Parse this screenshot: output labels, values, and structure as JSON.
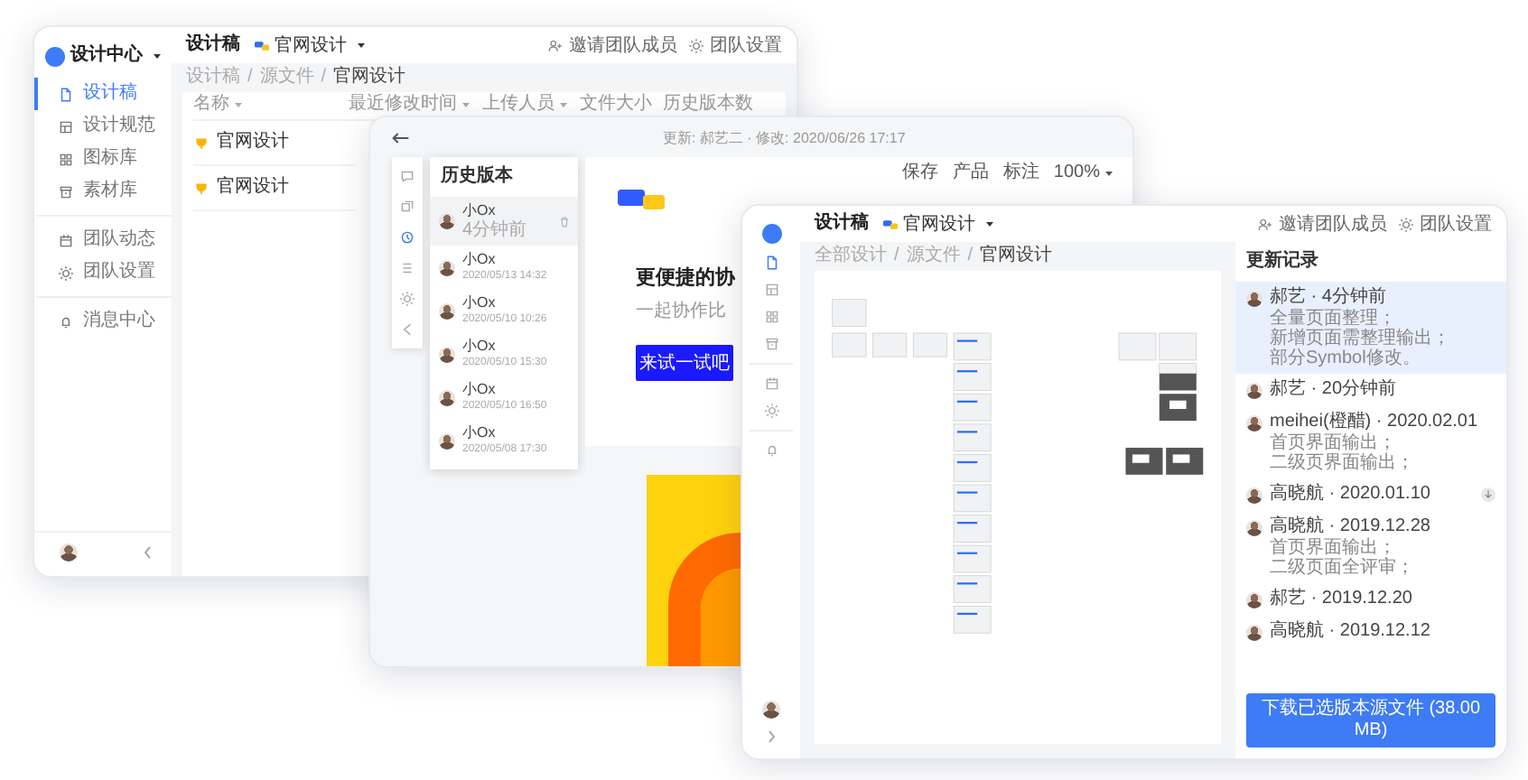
{
  "back_window": {
    "team": "设计中心",
    "nav": [
      {
        "label": "设计稿",
        "selected": true,
        "divider_before": false
      },
      {
        "label": "设计规范",
        "selected": false,
        "divider_before": false
      },
      {
        "label": "图标库",
        "selected": false,
        "divider_before": false
      },
      {
        "label": "素材库",
        "selected": false,
        "divider_before": false
      },
      {
        "label": "团队动态",
        "selected": false,
        "divider_before": true
      },
      {
        "label": "团队设置",
        "selected": false,
        "divider_before": false
      },
      {
        "label": "消息中心",
        "selected": false,
        "divider_before": true
      }
    ],
    "project": "设计稿",
    "file": "官网设计",
    "actions": [
      "邀请团队成员",
      "团队设置"
    ],
    "breadcrumb": [
      {
        "kind": "link",
        "text": "设计稿"
      },
      {
        "kind": "separator",
        "text": "/"
      },
      {
        "kind": "link",
        "text": "源文件"
      },
      {
        "kind": "separator",
        "text": "/"
      },
      {
        "kind": "current",
        "text": "官网设计"
      }
    ],
    "columns": [
      {
        "label": "名称",
        "sortable": true
      },
      {
        "label": "最近修改时间",
        "sortable": true
      },
      {
        "label": "上传人员",
        "sortable": true
      },
      {
        "label": "文件大小",
        "sortable": false
      },
      {
        "label": "历史版本数",
        "sortable": false
      }
    ],
    "rows": [
      {
        "name": "官网设计"
      },
      {
        "name": "官网设计"
      }
    ]
  },
  "middle_window": {
    "meta": "更新: 郝艺二 · 修改: 2020/06/26 17:17",
    "tools": [
      "保存",
      "产品",
      "标注"
    ],
    "zoom": "100%",
    "strip": [
      {
        "selected": false
      },
      {
        "selected": false
      },
      {
        "selected": true
      },
      {
        "selected": false
      },
      {
        "selected": false
      },
      {
        "selected": false
      }
    ],
    "history_title": "历史版本",
    "versions": [
      {
        "name": "小Ox",
        "time": "4分钟前",
        "selected": true
      },
      {
        "name": "小Ox",
        "time": "2020/05/13 14:32",
        "selected": false
      },
      {
        "name": "小Ox",
        "time": "2020/05/10 10:26",
        "selected": false
      },
      {
        "name": "小Ox",
        "time": "2020/05/10 15:30",
        "selected": false
      },
      {
        "name": "小Ox",
        "time": "2020/05/10 16:50",
        "selected": false
      },
      {
        "name": "小Ox",
        "time": "2020/05/08 17:30",
        "selected": false
      }
    ],
    "heading": "更便捷的协",
    "subtitle": "一起协作比",
    "cta": "来试一试吧"
  },
  "front_window": {
    "nav": [
      {
        "selected": true
      },
      {
        "selected": false
      },
      {
        "selected": false
      },
      {
        "selected": false
      },
      {
        "selected": false
      },
      {
        "selected": false
      },
      {
        "selected": false
      }
    ],
    "project": "设计稿",
    "file": "官网设计",
    "actions": [
      "邀请团队成员",
      "团队设置"
    ],
    "breadcrumb": [
      {
        "kind": "link",
        "text": "全部设计"
      },
      {
        "kind": "separator",
        "text": "/"
      },
      {
        "kind": "link",
        "text": "源文件"
      },
      {
        "kind": "separator",
        "text": "/"
      },
      {
        "kind": "current",
        "text": "官网设计"
      }
    ],
    "log_title": "更新记录",
    "log": [
      {
        "title": "郝艺 · 4分钟前",
        "notes": [
          "全量页面整理；",
          "新增页面需整理输出；",
          "部分Symbol修改。"
        ],
        "selected": true,
        "download": false
      },
      {
        "title": "郝艺 · 20分钟前",
        "selected": false,
        "download": false
      },
      {
        "title": "meihei(橙醋) · 2020.02.01",
        "notes": [
          "首页界面输出；",
          "二级页界面输出；"
        ],
        "selected": false,
        "download": false
      },
      {
        "title": "高晓航 · 2020.01.10",
        "selected": false,
        "download": true
      },
      {
        "title": "高晓航 · 2019.12.28",
        "notes": [
          "首页界面输出；",
          "二级页面全评审；"
        ],
        "selected": false,
        "download": false
      },
      {
        "title": "郝艺 · 2019.12.20",
        "selected": false,
        "download": false
      },
      {
        "title": "高晓航 · 2019.12.12",
        "selected": false,
        "download": false
      }
    ],
    "download_button": "下载已选版本源文件 (38.00 MB)"
  }
}
